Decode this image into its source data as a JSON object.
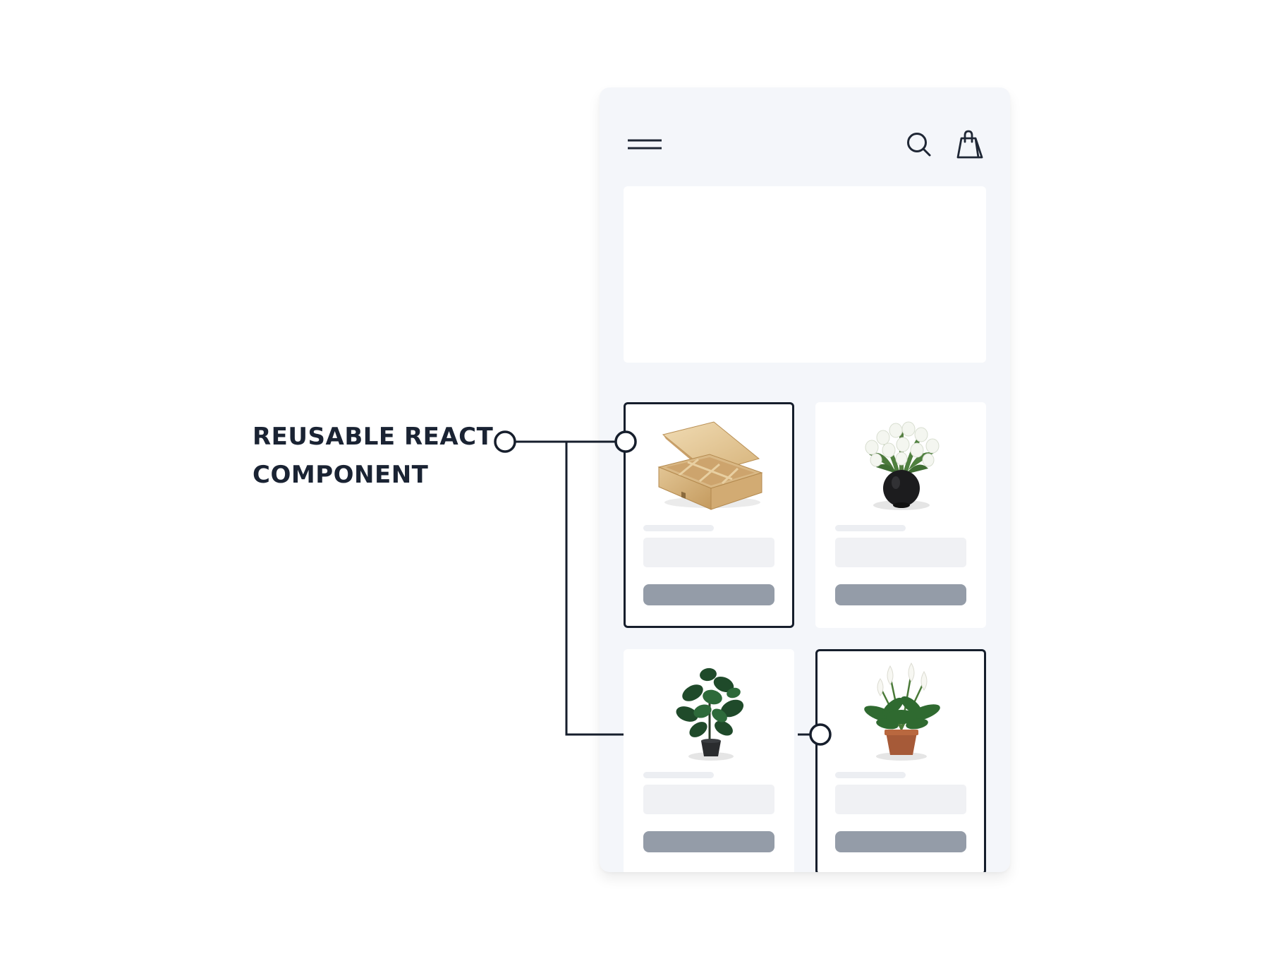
{
  "callout": {
    "line1": "REUSABLE REACT",
    "line2": "COMPONENT"
  },
  "colors": {
    "ink": "#161e2c",
    "phone_background": "#f4f6fa",
    "card_background": "#ffffff",
    "skeleton_light": "#f0f1f4",
    "skeleton_button": "#949ca8"
  },
  "header": {
    "menu_icon": "hamburger-menu-icon",
    "search_icon": "search-icon",
    "cart_icon": "shopping-bag-icon"
  },
  "products": [
    {
      "image": "wooden-box-image",
      "highlighted": true
    },
    {
      "image": "white-tulips-vase-image",
      "highlighted": false
    },
    {
      "image": "potted-rubber-plant-image",
      "highlighted": false
    },
    {
      "image": "peace-lily-pot-image",
      "highlighted": true
    }
  ]
}
